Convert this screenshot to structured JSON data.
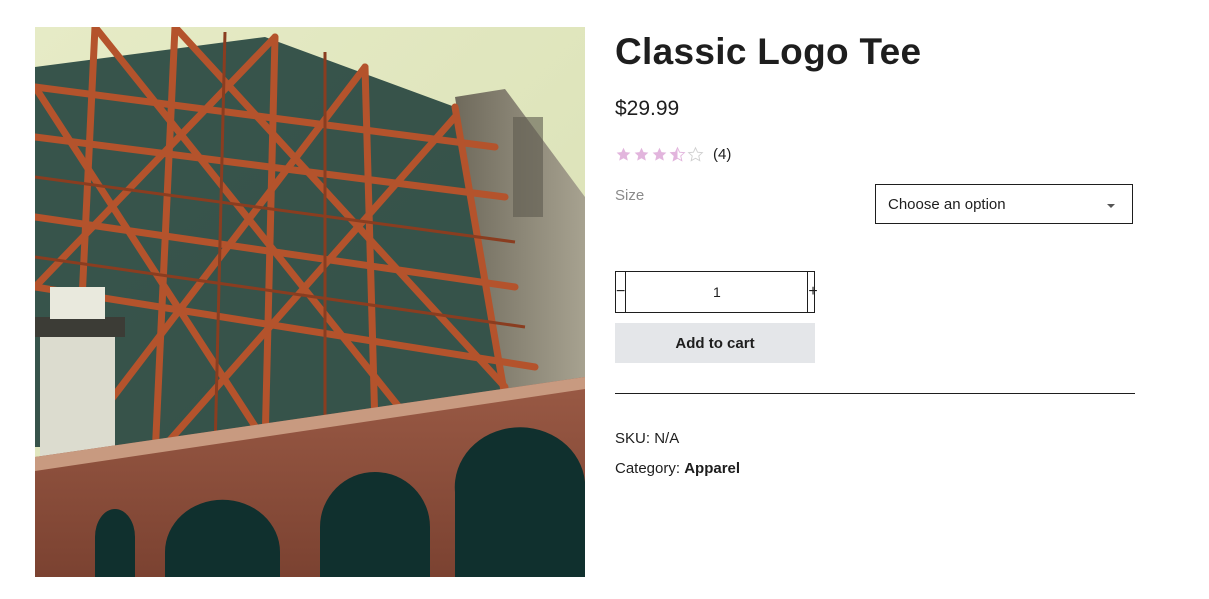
{
  "product": {
    "title": "Classic Logo Tee",
    "price": "$29.99",
    "image_description": "Low-angle photo of a steel bridge tower over a brick fort with arches",
    "rating": {
      "value": 3.5,
      "max": 5,
      "count_text": "(4)",
      "star_color": "#e2b5dd",
      "empty_star_color": "#cfcfcf"
    }
  },
  "variation": {
    "size_label": "Size",
    "select_value": "Choose an option"
  },
  "cart": {
    "minus_label": "−",
    "quantity": "1",
    "plus_label": "+",
    "add_label": "Add to cart",
    "button_color": "#e4e6e9"
  },
  "meta": {
    "sku_label": "SKU:",
    "sku_value": "N/A",
    "category_label": "Category:",
    "category_value": "Apparel"
  }
}
